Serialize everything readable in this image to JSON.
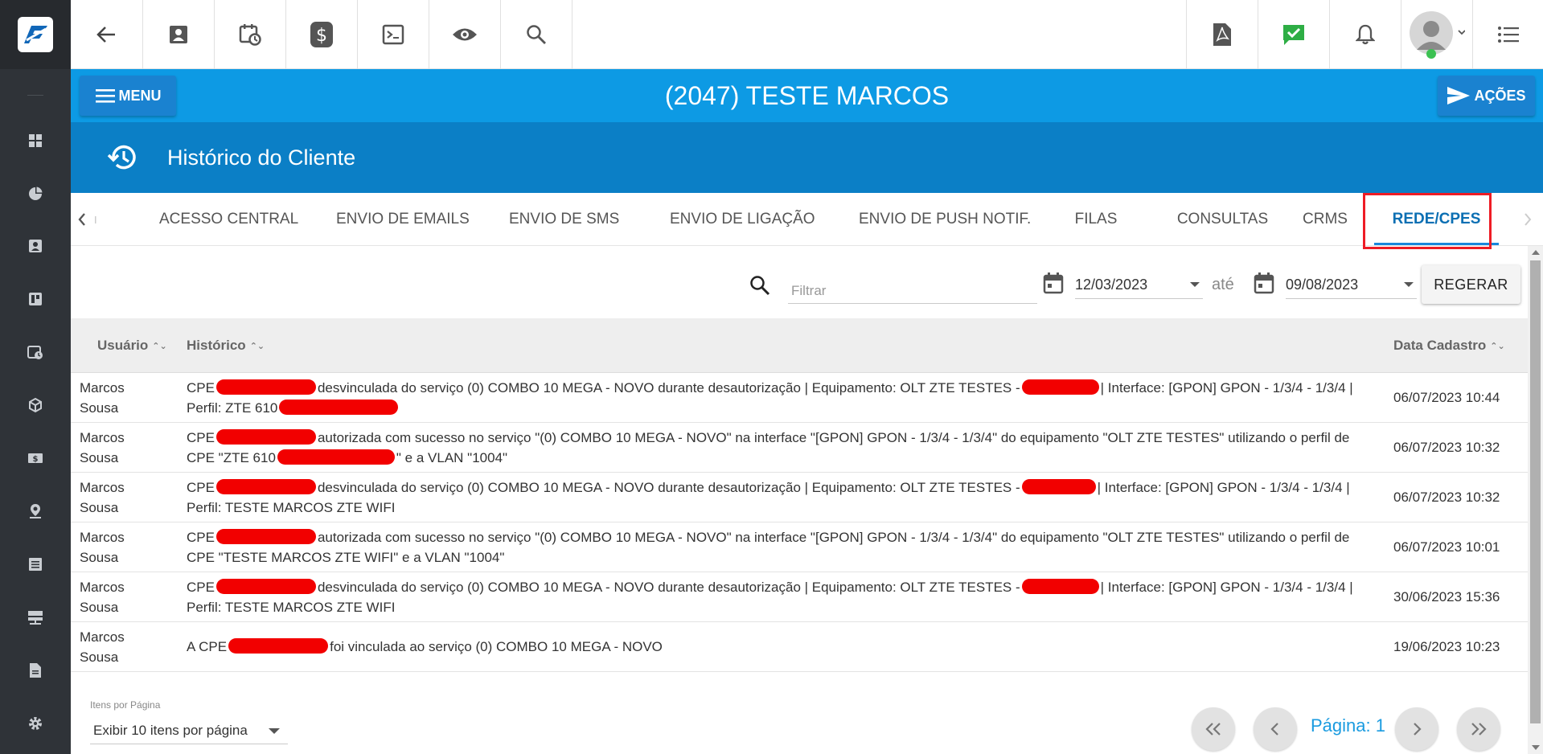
{
  "header": {
    "client_title": "(2047) TESTE MARCOS",
    "menu_label": "MENU",
    "acoes_label": "AÇÕES"
  },
  "section": {
    "title": "Histórico do Cliente"
  },
  "tabs": [
    {
      "label": "ACESSO CENTRAL",
      "active": false
    },
    {
      "label": "ENVIO DE EMAILS",
      "active": false
    },
    {
      "label": "ENVIO DE SMS",
      "active": false
    },
    {
      "label": "ENVIO DE LIGAÇÃO",
      "active": false
    },
    {
      "label": "ENVIO DE PUSH NOTIF.",
      "active": false
    },
    {
      "label": "FILAS",
      "active": false
    },
    {
      "label": "CONSULTAS",
      "active": false
    },
    {
      "label": "CRMS",
      "active": false
    },
    {
      "label": "REDE/CPES",
      "active": true
    }
  ],
  "filter": {
    "placeholder": "Filtrar",
    "date_from": "12/03/2023",
    "date_separator": "até",
    "date_to": "09/08/2023",
    "regerar_label": "REGERAR"
  },
  "table": {
    "columns": [
      "Usuário",
      "Histórico",
      "Data Cadastro"
    ],
    "rows": [
      {
        "user_line1": "Marcos",
        "user_line2": "Sousa",
        "h1a": "CPE",
        "h1b": "desvinculada do serviço (0) COMBO 10 MEGA - NOVO durante desautorização | Equipamento: OLT ZTE TESTES -",
        "h1c": "| Interface: [GPON] GPON - 1/3/4 - 1/3/4 |",
        "h2a": "Perfil: ZTE 610",
        "h2b": "",
        "date": "06/07/2023 10:44"
      },
      {
        "user_line1": "Marcos",
        "user_line2": "Sousa",
        "h1a": "CPE",
        "h1b": "autorizada com sucesso no serviço \"(0) COMBO 10 MEGA - NOVO\" na interface \"[GPON] GPON - 1/3/4 - 1/3/4\" do equipamento \"OLT ZTE TESTES\" utilizando o perfil de",
        "h1c": "",
        "h2a": "CPE \"ZTE 610",
        "h2b": "\" e a VLAN \"1004\"",
        "date": "06/07/2023 10:32"
      },
      {
        "user_line1": "Marcos",
        "user_line2": "Sousa",
        "h1a": "CPE",
        "h1b": "desvinculada do serviço (0) COMBO 10 MEGA - NOVO durante desautorização | Equipamento: OLT ZTE TESTES -",
        "h1c": "| Interface: [GPON] GPON - 1/3/4 - 1/3/4 |",
        "h2a": "Perfil: TESTE MARCOS ZTE WIFI",
        "h2b": "",
        "date": "06/07/2023 10:32"
      },
      {
        "user_line1": "Marcos",
        "user_line2": "Sousa",
        "h1a": "CPE",
        "h1b": "autorizada com sucesso no serviço \"(0) COMBO 10 MEGA - NOVO\" na interface \"[GPON] GPON - 1/3/4 - 1/3/4\" do equipamento \"OLT ZTE TESTES\" utilizando o perfil de",
        "h1c": "",
        "h2a": "CPE \"TESTE MARCOS ZTE WIFI\" e a VLAN \"1004\"",
        "h2b": "",
        "date": "06/07/2023 10:01"
      },
      {
        "user_line1": "Marcos",
        "user_line2": "Sousa",
        "h1a": "CPE",
        "h1b": "desvinculada do serviço (0) COMBO 10 MEGA - NOVO durante desautorização | Equipamento: OLT ZTE TESTES -",
        "h1c": "| Interface: [GPON] GPON - 1/3/4 - 1/3/4 |",
        "h2a": "Perfil: TESTE MARCOS ZTE WIFI",
        "h2b": "",
        "date": "30/06/2023 15:36"
      },
      {
        "user_line1": "Marcos",
        "user_line2": "Sousa",
        "h1a": "A CPE",
        "h1b": "foi vinculada ao serviço (0) COMBO 10 MEGA - NOVO",
        "h1c": "",
        "h2a": "",
        "h2b": "",
        "date": "19/06/2023 10:23"
      }
    ]
  },
  "footer": {
    "items_per_page_label": "Itens por Página",
    "items_per_page_value": "Exibir 10 itens por página",
    "page_label": "Página: 1"
  },
  "colors": {
    "sidebar": "#2f3338",
    "client_bar": "#0d9ae4",
    "section_bar": "#0b7fc6",
    "active_tab": "#0b6fb3",
    "highlight_box": "#ee1c25",
    "redaction": "#f20000"
  }
}
